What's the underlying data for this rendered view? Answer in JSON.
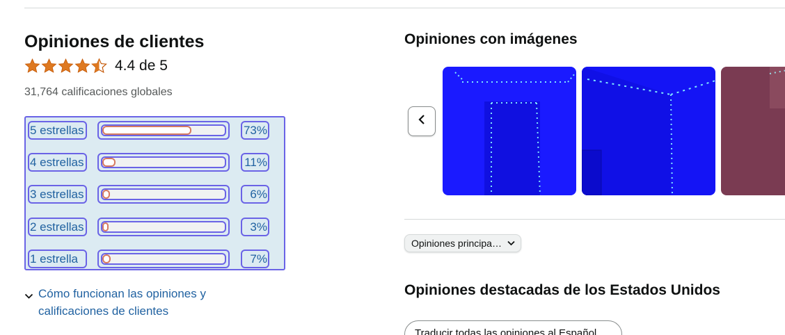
{
  "reviews": {
    "title": "Opiniones de clientes",
    "rating_text": "4.4 de 5",
    "rating_value": 4.4,
    "star_color": "#de7921",
    "global_ratings": "31,764 calificaciones globales",
    "histogram": [
      {
        "label": "5 estrellas",
        "percent_text": "73%",
        "percent": 73
      },
      {
        "label": "4 estrellas",
        "percent_text": "11%",
        "percent": 11
      },
      {
        "label": "3 estrellas",
        "percent_text": "6%",
        "percent": 6
      },
      {
        "label": "2 estrellas",
        "percent_text": "3%",
        "percent": 3
      },
      {
        "label": "1 estrella",
        "percent_text": "7%",
        "percent": 7
      }
    ],
    "how_it_works": "Cómo funcionan las opiniones y calificaciones de clientes"
  },
  "images_section": {
    "title": "Opiniones con imágenes",
    "prev_icon": "chevron-left-icon"
  },
  "sort": {
    "selected": "Opiniones principa…"
  },
  "featured": {
    "title": "Opiniones destacadas de los Estados Unidos",
    "translate_button": "Traducir todas las opiniones al Español"
  },
  "colors": {
    "link": "#2162a1",
    "bar_fill_border": "#d67a60",
    "highlight_border": "#6a63e6"
  }
}
